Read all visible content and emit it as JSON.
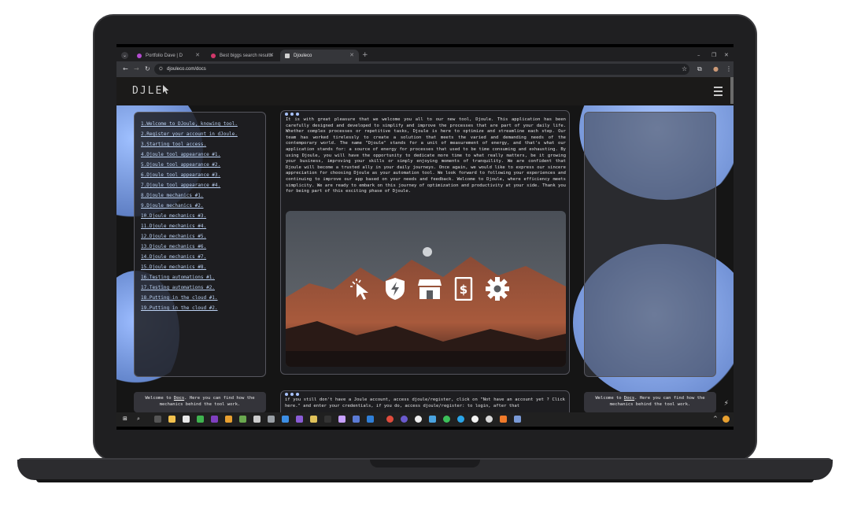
{
  "browser": {
    "tabs": [
      {
        "label": "Portfolio Dave | D",
        "color": "#b44bd0",
        "active": false
      },
      {
        "label": "Best biggs search results",
        "color": "#d2386a",
        "active": false
      },
      {
        "label": "Djouleco",
        "color": "#d1d1d1",
        "active": true
      }
    ],
    "url": "djouleco.com/docs"
  },
  "site": {
    "logo": "DJLE",
    "toc": [
      "1.Welcome to DJoule, knowing tool.",
      "2.Register your account in dJoule.",
      "3.Starting tool access.",
      "4.Djoule tool appearance #1.",
      "5.Djoule tool appearance #2.",
      "6.Djoule tool appearance #3.",
      "7.Djoule tool appearance #4.",
      "8.Djoule mechanics #1.",
      "9.Djoule mechanics #2.",
      "10.Djoule mechanics #3.",
      "11.Djoule mechanics #4.",
      "12.Djoule mechanics #5.",
      "13.Djoule mechanics #6.",
      "14.Djoule mechanics #7.",
      "15.Djoule mechanics #8.",
      "16.Testing automations #1.",
      "17.Testing automations #2.",
      "18.Putting in the cloud #1.",
      "19.Putting in the cloud #2."
    ],
    "intro_text": "It is with great pleasure that we welcome you all to our new tool, Djoule. This application has been carefully designed and developed to simplify and improve the processes that are part of your daily life. Whether complex processes or repetitive tasks, Djoule is here to optimize and streamline each step. Our team has worked tirelessly to create a solution that meets the varied and demanding needs of the contemporary world. The name \"Djoule\" stands for a unit of measurement of energy, and that's what our application stands for: a source of energy for processes that used to be time consuming and exhausting. By using Djoule, you will have the opportunity to dedicate more time to what really matters, be it growing your business, improving your skills or simply enjoying moments of tranquility. We are confident that Djoule will become a trusted ally in your daily journeys. Once again, we would like to express our sincere appreciation for choosing Djoule as your automation tool. We look forward to following your experiences and continuing to improve our app based on your needs and feedback. Welcome to Djoule, where efficiency meets simplicity. We are ready to embark on this journey of optimization and productivity at your side. Thank you for being part of this exciting phase of Djoule.",
    "note_prefix": "Welcome to ",
    "note_link": "Docs",
    "note_suffix": ". Here you can find how the mechanics behind the tool work.",
    "bottom_text": "if you still don't have a Joule account, access djoule/register, click on \"Not have an account yet ? Click here.\" and enter your credentials, if you do, access djoule/register: to login, after that",
    "hero_icons": [
      "cursor-click-icon",
      "shield-bolt-icon",
      "store-icon",
      "receipt-dollar-icon",
      "gear-icon"
    ]
  },
  "colors": {
    "accent": "#a9c3ff",
    "link": "#bcd2f3",
    "page_bg": "#151515"
  }
}
